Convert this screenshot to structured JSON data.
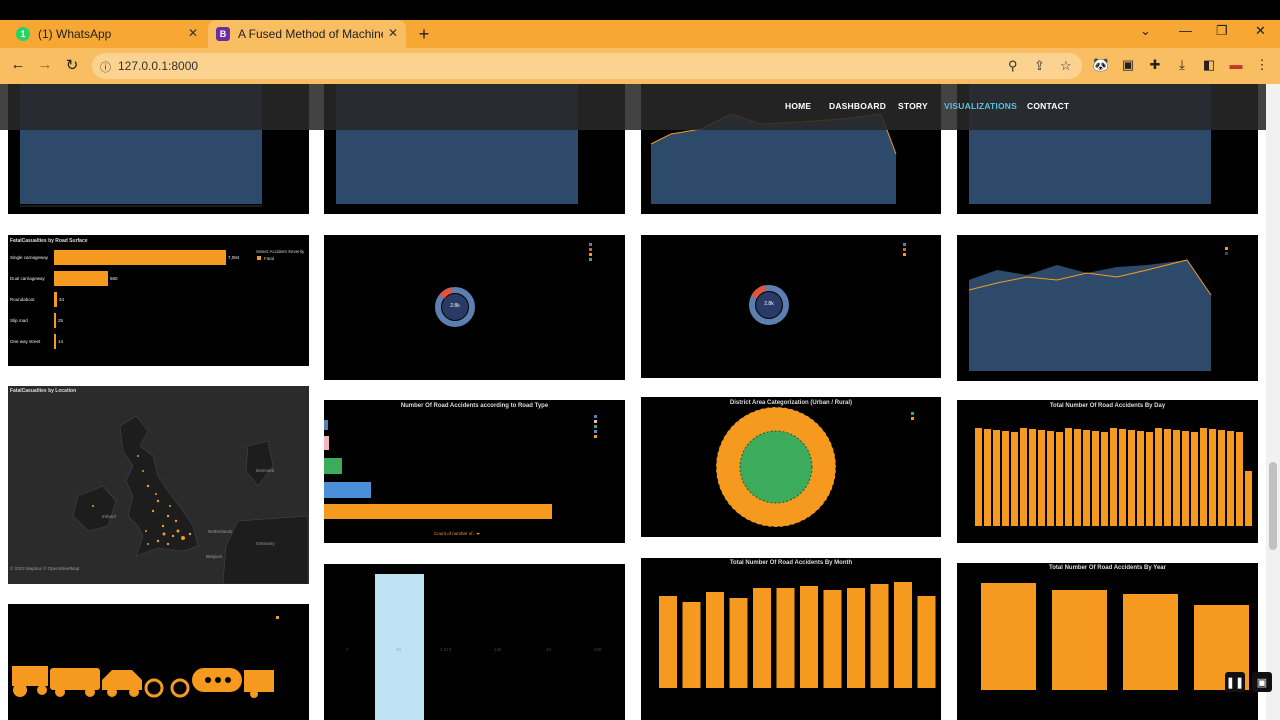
{
  "browser": {
    "tabs": [
      {
        "title": "(1) WhatsApp",
        "badge": "1",
        "color": "#25d366"
      },
      {
        "title": "A Fused Method of Machine Lear",
        "badge": "B",
        "color": "#6b2fa1"
      }
    ],
    "url": "127.0.0.1:8000"
  },
  "site_nav": {
    "items": [
      "HOME",
      "DASHBOARD",
      "STORY",
      "VISUALIZATIONS",
      "CONTACT"
    ],
    "active": "VISUALIZATIONS"
  },
  "visualizations": {
    "surface_title": "FatalCasualties by Road Surface",
    "surface_legend_title": "Select Accident Severity",
    "surface_legend_item": "Fatal",
    "surface_categories": [
      "Single carriageway",
      "Dual carriageway",
      "Roundabout",
      "Slip road",
      "One way street"
    ],
    "surface_values": [
      "7,084",
      "560",
      "34",
      "25",
      "14"
    ],
    "location_title": "FatalCasualties by Location",
    "map_labels": [
      "Denmark",
      "Ireland",
      "Netherlands",
      "Germany",
      "Belgium"
    ],
    "map_credit": "© 2023 Mapbox © OpenStreetMap",
    "donut_value_1": "2.8k",
    "donut_value_2": "2.8k",
    "road_type_title": "Number Of Road Accidents according to Road Type",
    "road_type_axis": "Count of number of.. ⬌",
    "district_title": "District Area Categorization (Urban / Rural)",
    "by_day_title": "Total Number Of Road Accidents By Day",
    "by_month_title": "Total Number Of Road Accidents By Month",
    "by_year_title": "Total Number Of Road Accidents By Year",
    "bar_stats": [
      "7",
      "49",
      "2,013",
      "135",
      "10",
      "229"
    ]
  },
  "colors": {
    "orange": "#f59a1f",
    "navy": "#2e4a6b",
    "green": "#3cab5c",
    "light_blue": "#bfe3f2",
    "donut": "#5b7fb0"
  }
}
